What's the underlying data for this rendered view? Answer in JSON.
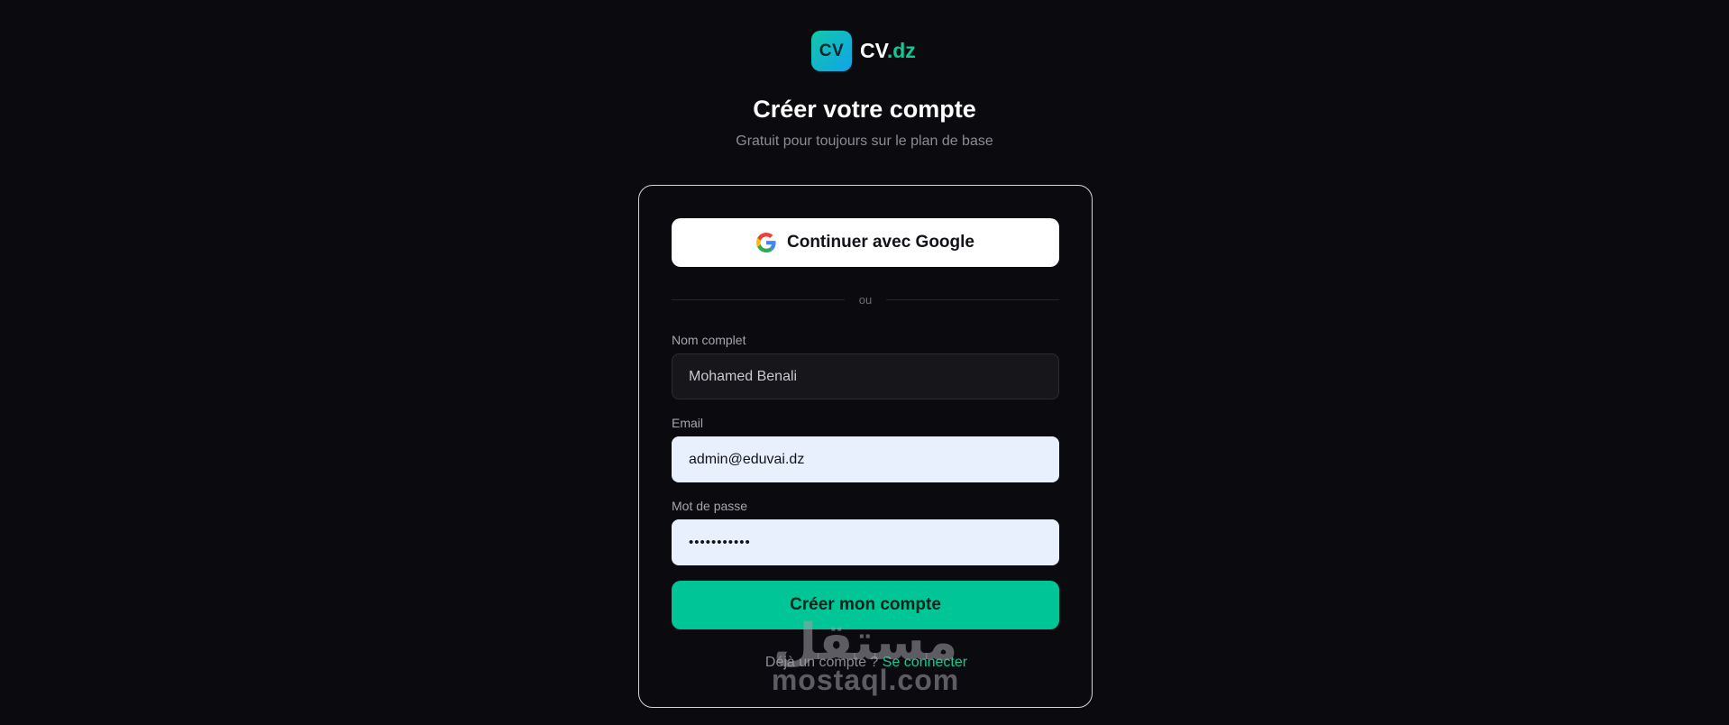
{
  "brand": {
    "logo_text": "CV",
    "name": "CV",
    "tld": ".dz",
    "gradient": [
      "#13c7a8",
      "#0ea5e9"
    ],
    "accent": "#10c995"
  },
  "header": {
    "title": "Créer votre compte",
    "subtitle": "Gratuit pour toujours sur le plan de base"
  },
  "form": {
    "google_label": "Continuer avec Google",
    "google_icon": "google-g-icon",
    "divider_text": "ou",
    "name": {
      "label": "Nom complet",
      "value": "Mohamed Benali"
    },
    "email": {
      "label": "Email",
      "value": "admin@eduvai.dz"
    },
    "password": {
      "label": "Mot de passe",
      "value": "•••••••••••"
    },
    "submit_label": "Créer mon compte",
    "submit_color": "#00c596"
  },
  "footer": {
    "prompt": "Déjà un compte ?",
    "link": "Se connecter"
  },
  "watermark": {
    "arabic": "مستقل",
    "latin": "mostaql.com"
  }
}
